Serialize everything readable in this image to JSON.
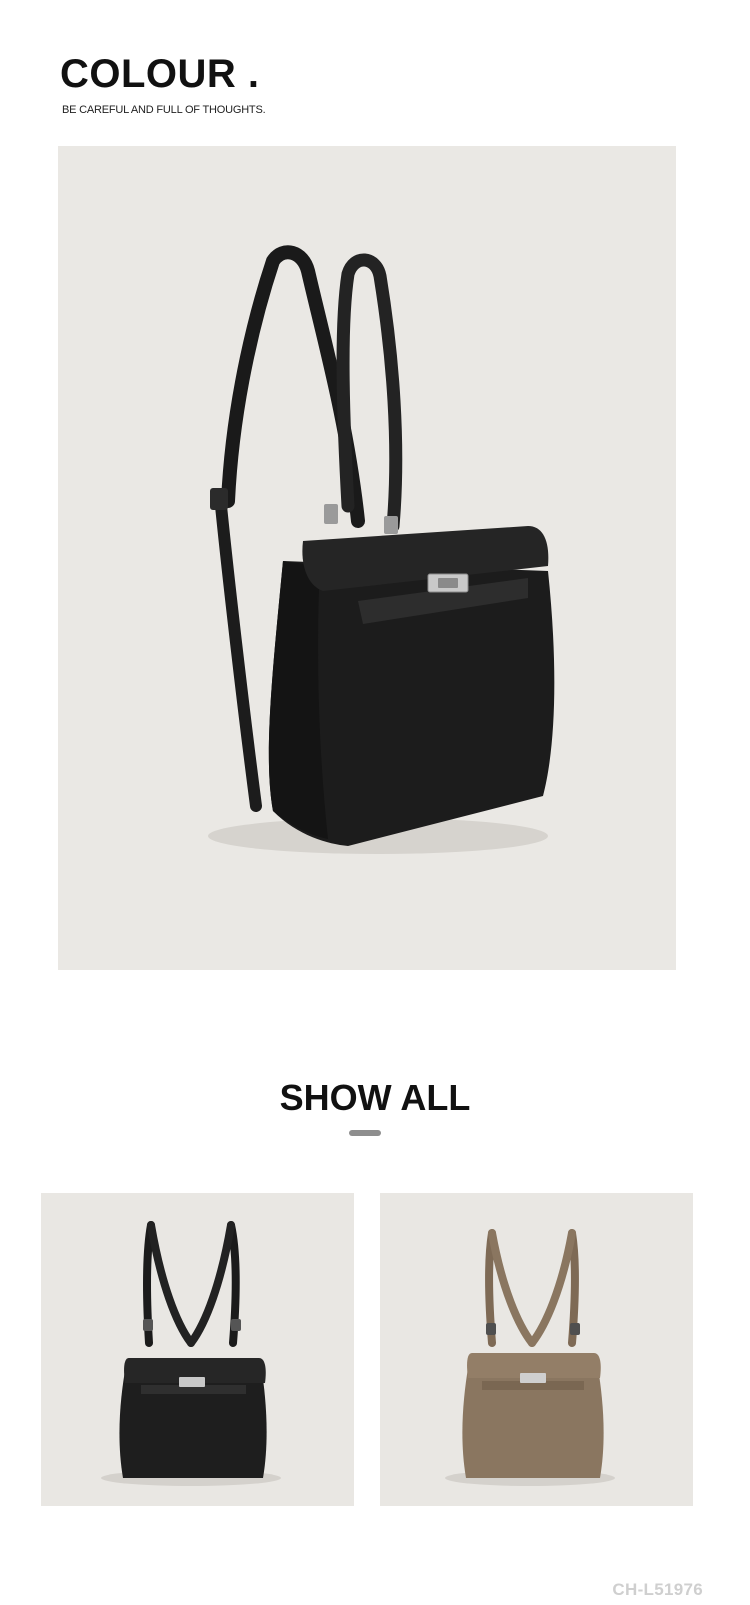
{
  "header": {
    "title": "COLOUR .",
    "subtitle": "BE CAREFUL AND FULL OF THOUGHTS."
  },
  "hero": {
    "image": "black-backpack-photo",
    "bag_color": "#1c1c1c",
    "background_color": "#eae8e4"
  },
  "show_all": {
    "title": "SHOW ALL",
    "divider_color": "#8e8e8e"
  },
  "variants": [
    {
      "image": "black-backpack-photo",
      "bag_color": "#1e1e1e"
    },
    {
      "image": "taupe-backpack-photo",
      "bag_color": "#8a7660"
    }
  ],
  "footer": {
    "product_code": "CH-L51976"
  }
}
